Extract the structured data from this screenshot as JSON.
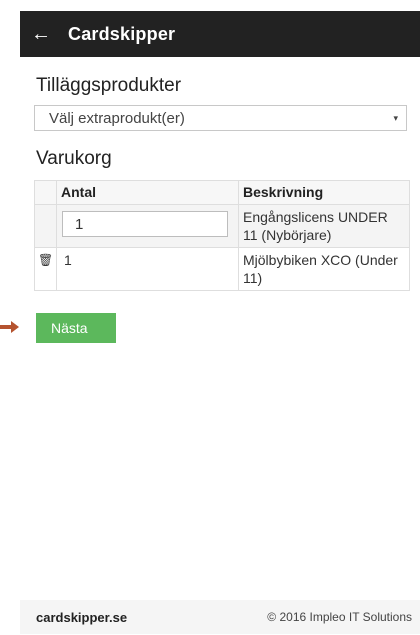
{
  "header": {
    "back_icon": "arrow-left-icon",
    "title": "Cardskipper"
  },
  "addons": {
    "heading": "Tilläggsprodukter",
    "select_value": "Välj extraprodukt(er)",
    "caret": "▾"
  },
  "cart": {
    "heading": "Varukorg",
    "columns": [
      "",
      "Antal",
      "Beskrivning"
    ],
    "rows": [
      {
        "quantity": "1",
        "description": "Engångslicens UNDER 11 (Nybörjare)"
      },
      {
        "quantity": "1",
        "description": "Mjölbybiken XCO (Under 11)",
        "trash_icon": "trash-icon"
      }
    ]
  },
  "next_button": "Nästa",
  "footer": {
    "brand": "cardskipper.se",
    "copyright": "© 2016 Impleo IT Solutions"
  },
  "colors": {
    "header_bg": "#222222",
    "button_green": "#5cb85c",
    "arrow": "#b5532f"
  }
}
